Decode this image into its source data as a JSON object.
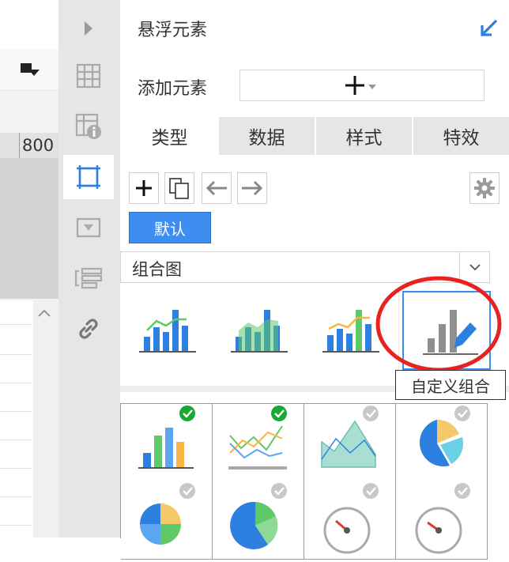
{
  "panel": {
    "title": "悬浮元素",
    "add_element_label": "添加元素",
    "tabs": [
      {
        "label": "类型",
        "active": true
      },
      {
        "label": "数据",
        "active": false
      },
      {
        "label": "样式",
        "active": false
      },
      {
        "label": "特效",
        "active": false
      }
    ],
    "default_button": "默认",
    "chart_category": "组合图",
    "tooltip": "自定义组合"
  },
  "canvas": {
    "ruler_value": "800"
  },
  "colors": {
    "accent": "#3d8ef0",
    "highlight_circle": "#e8231f",
    "check_green": "#1aa835"
  },
  "toolbar_icons": [
    "expand-arrow-icon",
    "table-icon",
    "cell-info-icon",
    "float-element-icon",
    "widget-icon",
    "layout-icon",
    "link-icon"
  ]
}
